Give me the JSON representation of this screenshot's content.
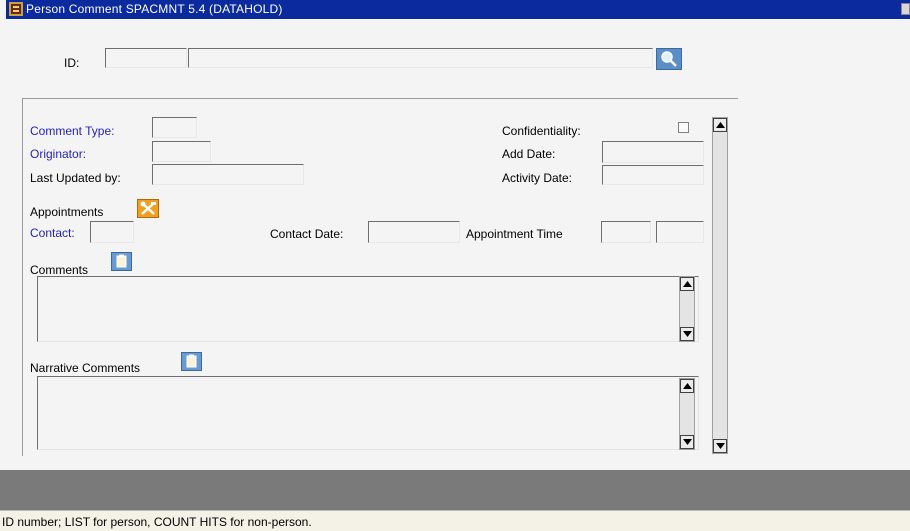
{
  "window": {
    "title": "Person Comment  SPACMNT  5.4  (DATAHOLD)",
    "app_icon": "form-icon"
  },
  "key_block": {
    "id_label": "ID:",
    "id_value": "",
    "name_value": "",
    "search_icon": "search-icon"
  },
  "form": {
    "comment_type_label": "Comment Type:",
    "originator_label": "Originator:",
    "last_updated_label": "Last Updated by:",
    "confidentiality_label": "Confidentiality:",
    "add_date_label": "Add Date:",
    "activity_date_label": "Activity Date:",
    "appointments_label": "Appointments",
    "contact_label": "Contact:",
    "contact_date_label": "Contact Date:",
    "appointment_time_label": "Appointment Time",
    "comments_label": "Comments",
    "narrative_label": "Narrative Comments",
    "comment_type_value": "",
    "originator_value": "",
    "last_updated_value": "",
    "add_date_value": "",
    "activity_date_value": "",
    "contact_value": "",
    "contact_date_value": "",
    "appointment_hour_value": "",
    "appointment_minute_value": "",
    "comments_value": "",
    "narrative_value": ""
  },
  "status": {
    "hint": "ID number; LIST for person, COUNT HITS for non-person."
  },
  "colors": {
    "titlebar": "#0a2a9e",
    "required_label": "#2424b8",
    "bottom_bar": "#7a7a7a",
    "status_bar": "#f4f2e6"
  }
}
